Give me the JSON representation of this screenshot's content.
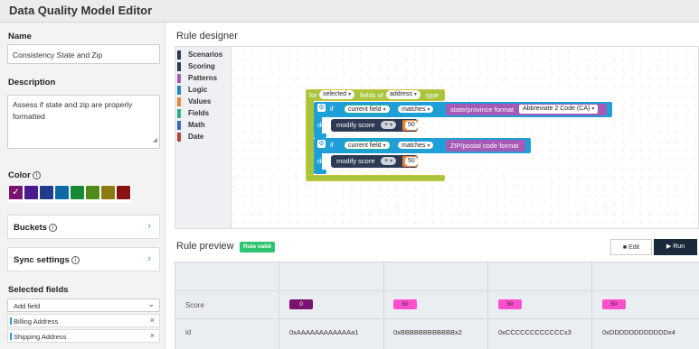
{
  "header": {
    "title": "Data Quality Model Editor"
  },
  "left_panel": {
    "name_label": "Name",
    "name_value": "Consistency State and Zip",
    "description_label": "Description",
    "description_value": "Assess if state and zip are properly formatted",
    "color_label": "Color",
    "colors": [
      "#7a1470",
      "#4a1a8f",
      "#1f3b8a",
      "#0f6aa8",
      "#178a3a",
      "#4f8a1a",
      "#8a7a10",
      "#8a1212"
    ],
    "buckets_label": "Buckets",
    "sync_label": "Sync settings",
    "selected_fields_label": "Selected fields",
    "add_field_placeholder": "Add field",
    "fields": [
      {
        "name": "Billing Address"
      },
      {
        "name": "Shipping Address"
      }
    ]
  },
  "designer": {
    "title": "Rule designer",
    "toolbox": [
      {
        "label": "Scenarios",
        "color": "#2d3a55"
      },
      {
        "label": "Scoring",
        "color": "#2d3a55"
      },
      {
        "label": "Patterns",
        "color": "#a55bb5"
      },
      {
        "label": "Logic",
        "color": "#1e88c7"
      },
      {
        "label": "Values",
        "color": "#e8833a"
      },
      {
        "label": "Fields",
        "color": "#2bb08a"
      },
      {
        "label": "Math",
        "color": "#3b67b8"
      },
      {
        "label": "Date",
        "color": "#b5423a"
      }
    ],
    "blocks": {
      "for_text": "for",
      "selected": "selected",
      "fields_of": "fields of",
      "address": "address",
      "type": "type",
      "if1": "if",
      "current_field1": "current field",
      "matches1": "matches",
      "state_format": "state/province format",
      "state_option": "Abbreviate 2 Code (CA)",
      "do1": "do",
      "modify1": "modify score",
      "op1": "+",
      "val1": "50",
      "if2": "if",
      "current_field2": "current field",
      "matches2": "matches",
      "zip_format": "ZIP/postal code format",
      "do2": "do",
      "modify2": "modify score",
      "op2": "+",
      "val2": "50"
    }
  },
  "preview": {
    "title": "Rule preview",
    "status": "Rule valid",
    "edit_label": "Edit",
    "run_label": "Run",
    "rows": [
      {
        "label": "Score",
        "values": [
          "0",
          "50",
          "50",
          "50"
        ]
      },
      {
        "label": "id",
        "values": [
          "0xAAAAAAAAAAAAa1",
          "0xBBBBBBBBBBBBx2",
          "0xCCCCCCCCCCCCx3",
          "0xDDDDDDDDDDDDx4"
        ]
      }
    ]
  }
}
